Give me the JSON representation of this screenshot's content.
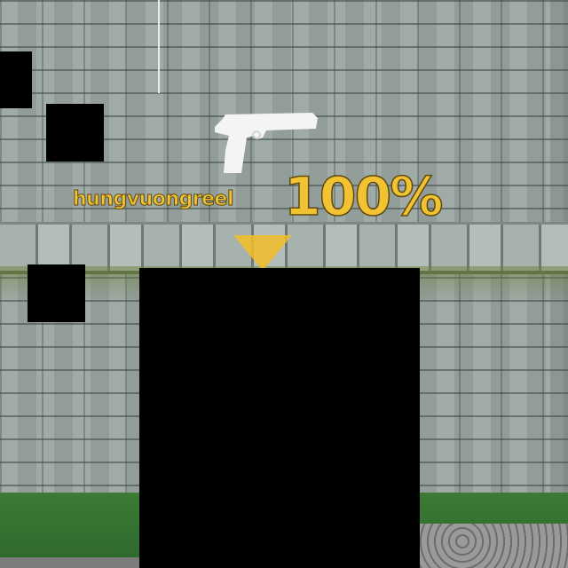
{
  "hud": {
    "player_name": "hungvuongreel",
    "health_percent_label": "100%",
    "health_percent": 100,
    "weapon_icon": "pistol-icon",
    "marker_icon": "triangle-down-icon",
    "accent_color": "#f1c232"
  }
}
